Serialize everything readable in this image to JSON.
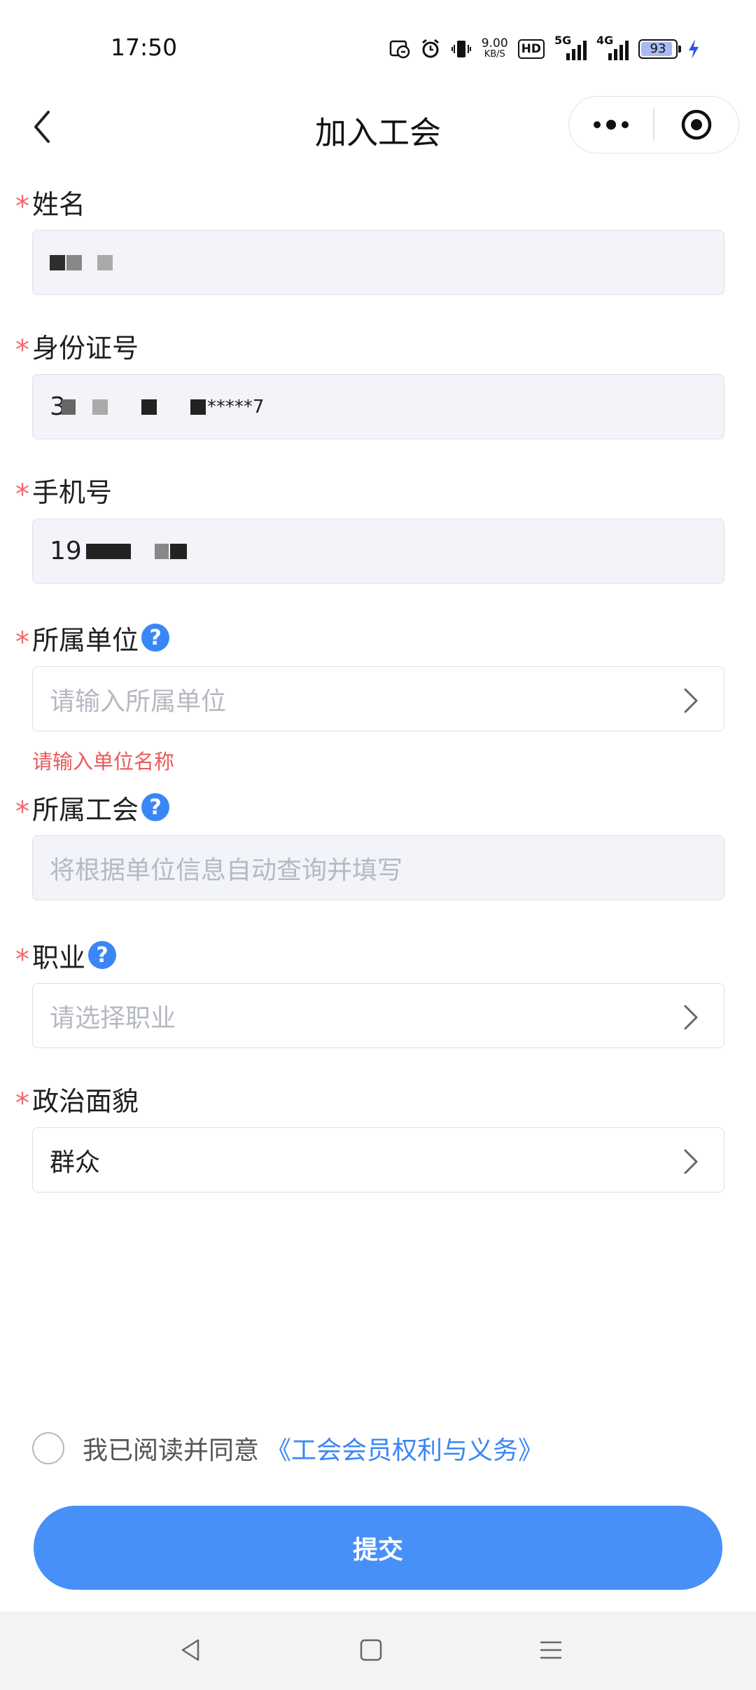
{
  "status_bar": {
    "time": "17:50",
    "net_speed_value": "9.00",
    "net_speed_unit": "KB/S",
    "hd_label": "HD",
    "net1_label": "5G",
    "net2_label": "4G",
    "battery_level": "93",
    "icons": [
      "nfc-icon",
      "alarm-icon",
      "vibrate-icon",
      "charging-bolt-icon"
    ]
  },
  "nav": {
    "title": "加入工会"
  },
  "form": {
    "name": {
      "label": "姓名",
      "value": ""
    },
    "id_number": {
      "label": "身份证号",
      "value_prefix": "3",
      "value_suffix": "*****7"
    },
    "phone": {
      "label": "手机号",
      "value_prefix": "19"
    },
    "employer": {
      "label": "所属单位",
      "placeholder": "请输入所属单位",
      "error": "请输入单位名称"
    },
    "union": {
      "label": "所属工会",
      "placeholder": "将根据单位信息自动查询并填写"
    },
    "occupation": {
      "label": "职业",
      "placeholder": "请选择职业"
    },
    "political_status": {
      "label": "政治面貌",
      "value": "群众"
    },
    "required_mark": "*",
    "help_mark": "?"
  },
  "agreement": {
    "text": "我已阅读并同意",
    "link": "《工会会员权利与义务》"
  },
  "submit_label": "提交",
  "colors": {
    "accent": "#4790f7",
    "required": "#f06b6b",
    "error": "#e85b5b",
    "input_bg": "#f2f4f9"
  }
}
